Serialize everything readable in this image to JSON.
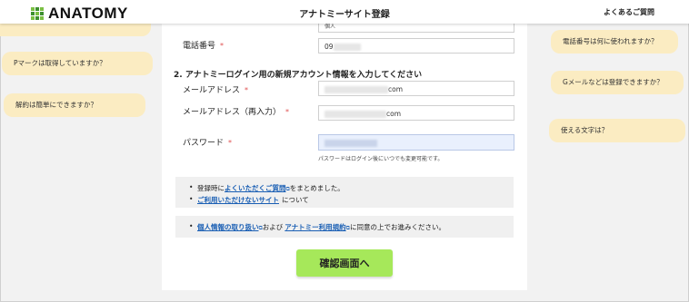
{
  "header": {
    "logo_text": "ANATOMY",
    "title": "アナトミーサイト登録",
    "faq_link": "よくあるご質問"
  },
  "form": {
    "phone": {
      "label": "電話番号",
      "required": "*",
      "value": "09"
    },
    "section_title": "2. アナトミーログイン用の新規アカウント情報を入力してください",
    "email": {
      "label": "メールアドレス",
      "required": "*",
      "value_suffix": "com"
    },
    "email_confirm": {
      "label": "メールアドレス（再入力）",
      "required": "*",
      "value_suffix": "com"
    },
    "password": {
      "label": "パスワード",
      "required": "*",
      "hint": "パスワードはログイン後にいつでも変更可能です。"
    },
    "submit_label": "確認画面へ"
  },
  "notices": {
    "line1_prefix": "登録時に",
    "line1_link": "よくいただくご質問",
    "line1_suffix": "をまとめました。",
    "line2_link": "ご利用いただけないサイト",
    "line2_suffix": "について",
    "line3_link1": "個人情報の取り扱い",
    "line3_mid": "および",
    "line3_link2": "アナトミー利用規約",
    "line3_suffix": "に同意の上でお進みください。"
  },
  "bubbles": {
    "left": [
      "Pマークは取得していますか？",
      "解約は簡単にできますか？"
    ],
    "right": [
      "電話番号は何に使われますか？",
      "Gメールなどは登録できますか？",
      "使える文字は？"
    ]
  },
  "colors": {
    "accent_button": "#a6e85a",
    "link": "#1a5fb4",
    "bubble": "#fbecc2",
    "required": "#e05050",
    "logo_squares": [
      "#7bc043",
      "#3d8f2f",
      "#7bc043",
      "#3d8f2f",
      "#7bc043",
      "#3d8f2f",
      "#7bc043",
      "#3d8f2f",
      "#7bc043"
    ]
  }
}
